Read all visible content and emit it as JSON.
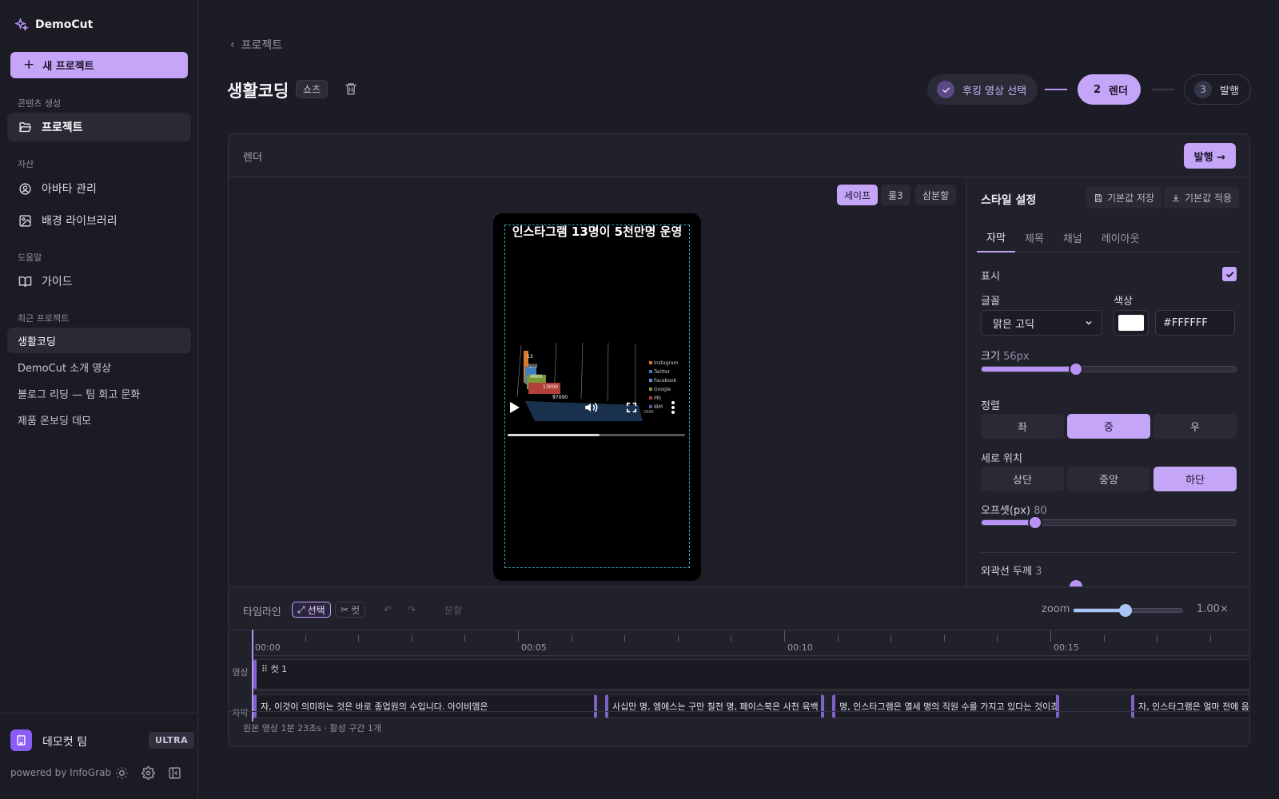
{
  "sidebar": {
    "brand": "DemoCut",
    "new_project": "새 프로젝트",
    "sections": {
      "content": "콘텐츠 생성",
      "assets": "자산",
      "help": "도움말",
      "recent": "최근 프로젝트"
    },
    "nav": {
      "projects": "프로젝트",
      "avatars": "아바타 관리",
      "backgrounds": "배경 라이브러리",
      "guide": "가이드"
    },
    "recent_projects": [
      "생활코딩",
      "DemoCut 소개 영상",
      "블로그 리딩 — 팀 회고 문화",
      "제품 온보딩 데모"
    ],
    "team": {
      "name": "데모컷 팀",
      "plan": "ULTRA"
    },
    "powered_by": "powered by InfoGrab"
  },
  "header": {
    "breadcrumb": "프로젝트",
    "title": "생활코딩",
    "type_badge": "쇼츠",
    "steps": [
      {
        "label": "후킹 영상 선택",
        "state": "done"
      },
      {
        "num": "2",
        "label": "렌더",
        "state": "current"
      },
      {
        "num": "3",
        "label": "발행",
        "state": "pending"
      }
    ]
  },
  "panel": {
    "label": "렌더",
    "publish": "발행 →",
    "guides": [
      "세이프",
      "룰3",
      "삼분할"
    ],
    "active_guide": "세이프"
  },
  "preview": {
    "overlay_title": "인스타그램 13명이 5천만명 운영",
    "playback_progress": 0.52,
    "chart_legend": [
      "Instagram",
      "Twitter",
      "Facebook",
      "Google",
      "MS",
      "IBM"
    ],
    "chart_labels": [
      "13",
      "900",
      "4600",
      "13000",
      "97000",
      "2990"
    ]
  },
  "style": {
    "title": "스타일 설정",
    "save_default": "기본값 저장",
    "apply_default": "기본값 적용",
    "tabs": [
      "자막",
      "제목",
      "채널",
      "레이아웃"
    ],
    "active_tab": "자막",
    "show_label": "표시",
    "show_checked": true,
    "font_label": "글꼴",
    "font_value": "맑은 고딕",
    "color_label": "색상",
    "color_value": "#FFFFFF",
    "size_label": "크기",
    "size_value": "56px",
    "size_fraction": 0.37,
    "align_label": "정렬",
    "align_options": [
      "좌",
      "중",
      "우"
    ],
    "align_active": "중",
    "vpos_label": "세로 위치",
    "vpos_options": [
      "상단",
      "중앙",
      "하단"
    ],
    "vpos_active": "하단",
    "offset_label": "오프셋(px)",
    "offset_value": "80",
    "offset_fraction": 0.21,
    "outline_label": "외곽선 두께",
    "outline_value": "3"
  },
  "timeline": {
    "label": "타임라인",
    "tools": {
      "select": "선택",
      "cut": "컷",
      "split": "분할"
    },
    "zoom_label": "zoom",
    "zoom_value": "1.00×",
    "zoom_fraction": 0.48,
    "time_marks": [
      "00:00",
      "00:05",
      "00:10",
      "00:15"
    ],
    "tracks": {
      "video": "영상",
      "subtitle": "자막"
    },
    "video_clip": "⠿ 컷 1",
    "subtitles": [
      "자, 이것이 의미하는 것은 바로 종업원의 수입니다. 아이비엠은",
      "사십만 명, 엠에스는 구만 칠천 명, 페이스북은 사천 육백",
      "명, 인스타그램은 열세 명의 직원 수를 가지고 있다는 것이죠.",
      "자, 인스타그램은 얼마 전에 음 페"
    ],
    "status": "원본 영상 1분 23초s · 활성 구간 1개"
  },
  "colors": {
    "accent": "#c4a5f7",
    "background": "#1c1c26",
    "safe_guide": "#3ea3b8"
  }
}
